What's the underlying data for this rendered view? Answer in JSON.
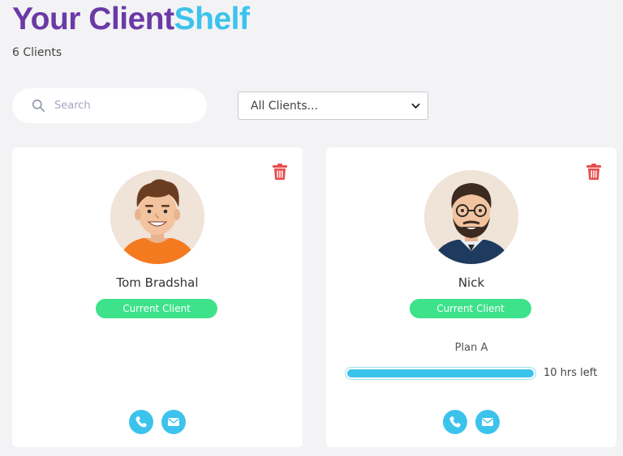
{
  "header": {
    "title_part1": "Your Client",
    "title_part2": "Shelf",
    "count": "6 Clients"
  },
  "search": {
    "placeholder": "Search",
    "icon": "search-icon"
  },
  "filter": {
    "selected": "All Clients..."
  },
  "colors": {
    "brand_purple": "#6b3aa6",
    "brand_cyan": "#3cc3ec",
    "status_green": "#3de28a",
    "delete_red": "#e84d4d"
  },
  "clients": [
    {
      "name": "Tom Bradshal",
      "status": "Current Client",
      "avatar_icon": "avatar-tom-icon"
    },
    {
      "name": "Nick",
      "status": "Current Client",
      "avatar_icon": "avatar-nick-icon",
      "plan": "Plan A",
      "plan_progress": 1.0,
      "hours_left": "10 hrs left"
    }
  ]
}
